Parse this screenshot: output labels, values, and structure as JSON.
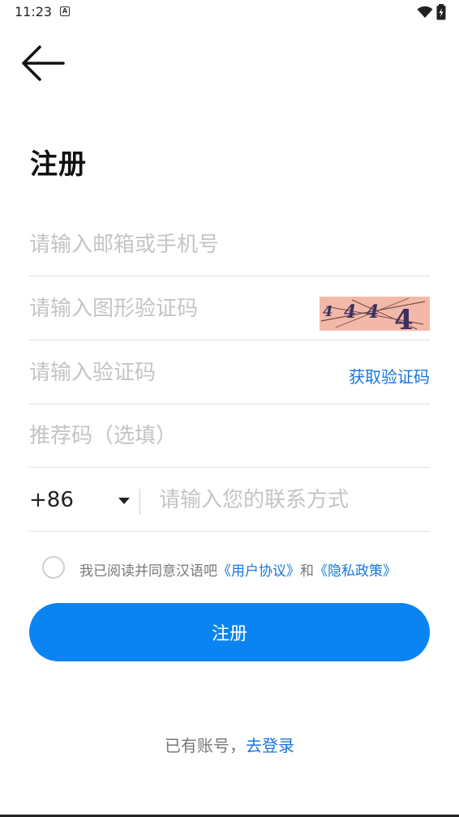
{
  "status_bar": {
    "time": "11:23",
    "notification_icon": "a-icon",
    "wifi_icon": "wifi-icon",
    "battery_icon": "battery-icon"
  },
  "header": {
    "back_icon": "arrow-left-icon",
    "title": "注册"
  },
  "form": {
    "account": {
      "placeholder": "请输入邮箱或手机号",
      "value": ""
    },
    "captcha": {
      "placeholder": "请输入图形验证码",
      "value": "",
      "image_text": "4 4 4 4"
    },
    "sms_code": {
      "placeholder": "请输入验证码",
      "value": "",
      "action_label": "获取验证码"
    },
    "referral": {
      "placeholder": "推荐码（选填）",
      "value": ""
    },
    "contact": {
      "country_code": "+86",
      "placeholder": "请输入您的联系方式",
      "value": ""
    }
  },
  "agreement": {
    "checked": false,
    "prefix": "我已阅读并同意汉语吧",
    "terms_link": "《用户协议》",
    "conjunction": "和",
    "privacy_link": "《隐私政策》"
  },
  "register_button": "注册",
  "login": {
    "prompt": "已有账号，",
    "link": "去登录"
  },
  "colors": {
    "accent": "#0a84f2",
    "link": "#1677e0",
    "placeholder": "#c4c4c4",
    "divider": "#e0e0e0"
  }
}
